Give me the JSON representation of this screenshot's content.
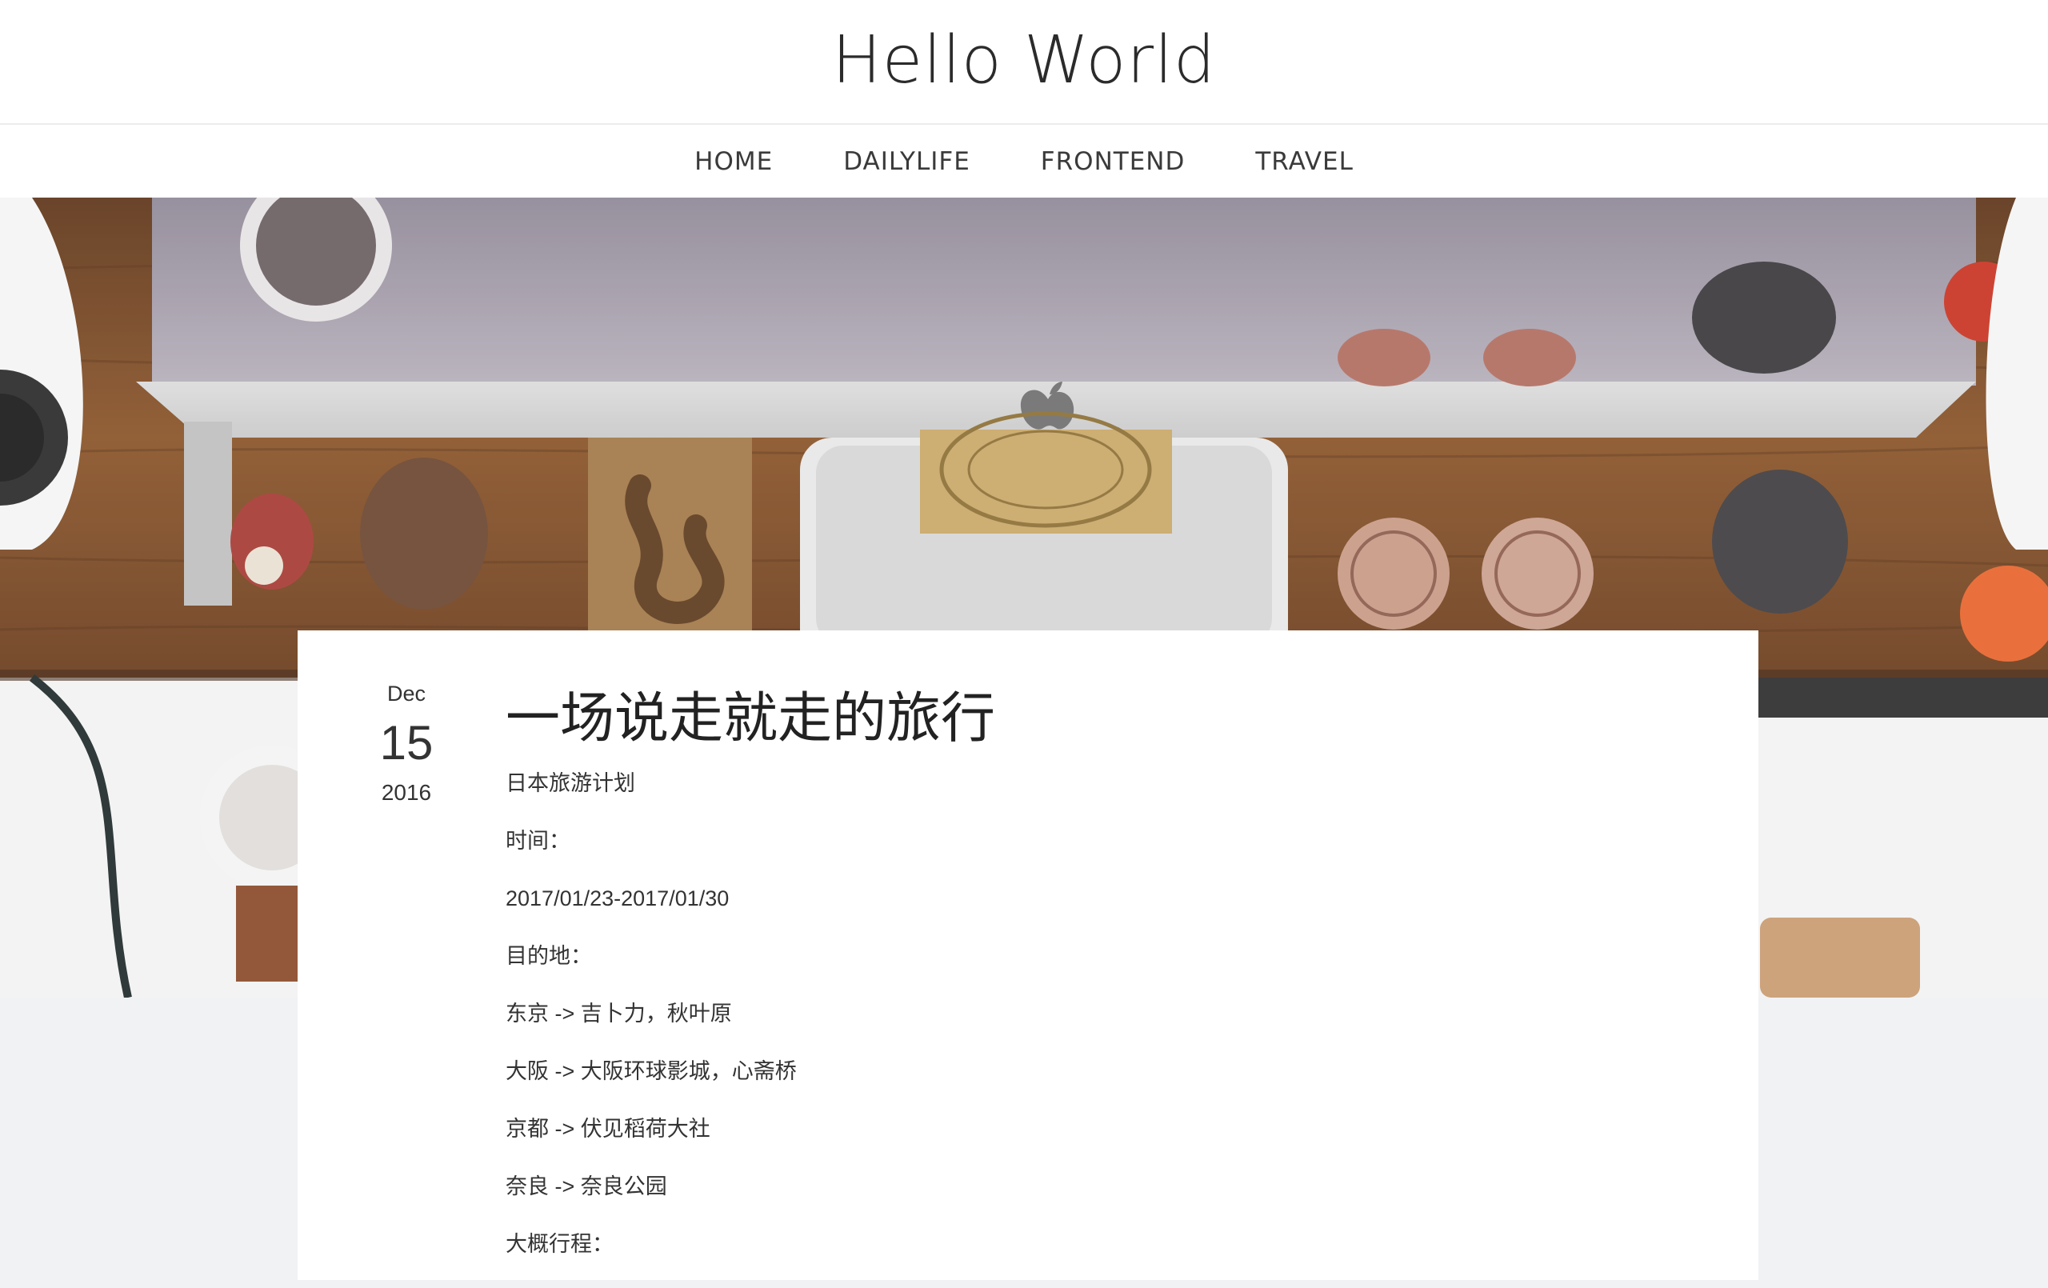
{
  "site": {
    "title": "Hello World"
  },
  "nav": {
    "items": [
      {
        "label": "HOME"
      },
      {
        "label": "DAILYLIFE"
      },
      {
        "label": "FRONTEND"
      },
      {
        "label": "TRAVEL"
      }
    ]
  },
  "post": {
    "date": {
      "month": "Dec",
      "day": "15",
      "year": "2016"
    },
    "title": "一场说走就走的旅行",
    "lines": [
      "日本旅游计划",
      "时间：",
      "2017/01/23-2017/01/30",
      "目的地：",
      "东京 -> 吉卜力，秋叶原",
      "大阪 -> 大阪环球影城，心斋桥",
      "京都 -> 伏见稻荷大社",
      "奈良 -> 奈良公园",
      "大概行程："
    ]
  },
  "colors": {
    "header_bg": "#ffffff",
    "page_bg": "#f1f2f4",
    "desk_wood": "#7a4a24",
    "text": "#333333"
  }
}
